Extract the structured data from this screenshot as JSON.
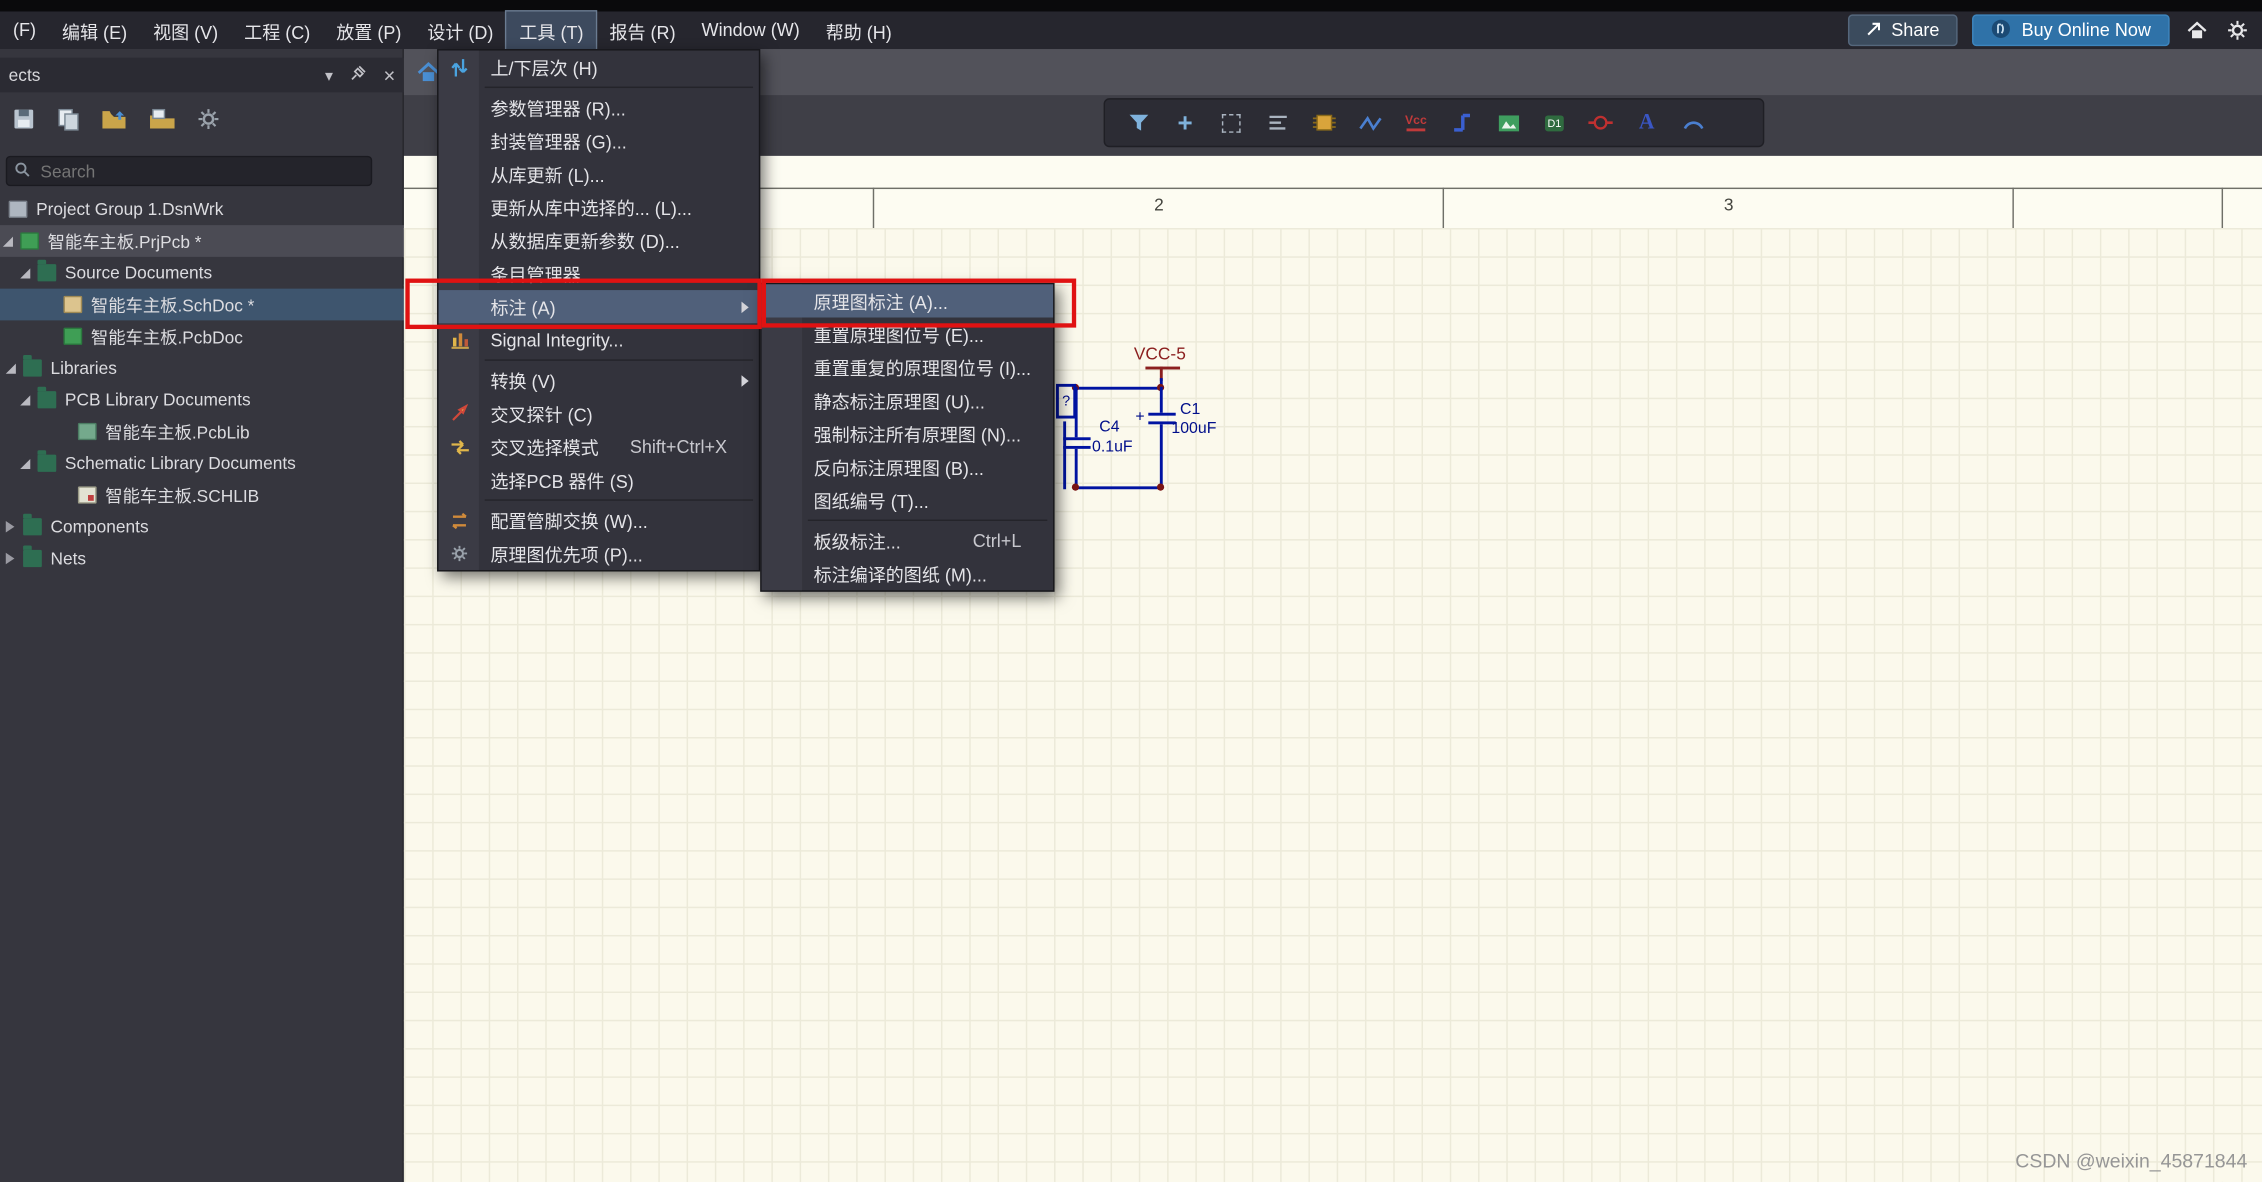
{
  "menubar": {
    "items": [
      {
        "label": "(F)"
      },
      {
        "label": "编辑 (E)"
      },
      {
        "label": "视图 (V)"
      },
      {
        "label": "工程 (C)"
      },
      {
        "label": "放置 (P)"
      },
      {
        "label": "设计 (D)"
      },
      {
        "label": "工具 (T)"
      },
      {
        "label": "报告 (R)"
      },
      {
        "label": "Window (W)"
      },
      {
        "label": "帮助 (H)"
      }
    ],
    "share_label": "Share",
    "buy_label": "Buy Online Now"
  },
  "tools_menu": {
    "items": [
      {
        "label": "上/下层次 (H)"
      },
      {
        "label": "参数管理器 (R)..."
      },
      {
        "label": "封装管理器 (G)..."
      },
      {
        "label": "从库更新 (L)..."
      },
      {
        "label": "更新从库中选择的... (L)..."
      },
      {
        "label": "从数据库更新参数 (D)..."
      },
      {
        "label": "条目管理器..."
      },
      {
        "label": "标注 (A)"
      },
      {
        "label": "Signal Integrity..."
      },
      {
        "label": "转换 (V)"
      },
      {
        "label": "交叉探针 (C)"
      },
      {
        "label": "交叉选择模式",
        "shortcut": "Shift+Ctrl+X"
      },
      {
        "label": "选择PCB 器件 (S)"
      },
      {
        "label": "配置管脚交换 (W)..."
      },
      {
        "label": "原理图优先项 (P)..."
      }
    ]
  },
  "annotate_submenu": {
    "items": [
      {
        "label": "原理图标注 (A)..."
      },
      {
        "label": "重置原理图位号 (E)..."
      },
      {
        "label": "重置重复的原理图位号 (I)..."
      },
      {
        "label": "静态标注原理图 (U)..."
      },
      {
        "label": "强制标注所有原理图 (N)..."
      },
      {
        "label": "反向标注原理图 (B)..."
      },
      {
        "label": "图纸编号 (T)..."
      },
      {
        "label": "板级标注...",
        "shortcut": "Ctrl+L"
      },
      {
        "label": "标注编译的图纸 (M)..."
      }
    ]
  },
  "projects_panel": {
    "header_title": "ects",
    "search_placeholder": "Search",
    "tree": [
      {
        "label": "Project Group 1.DsnWrk"
      },
      {
        "label": "智能车主板.PrjPcb *"
      },
      {
        "label": "Source Documents"
      },
      {
        "label": "智能车主板.SchDoc *"
      },
      {
        "label": "智能车主板.PcbDoc"
      },
      {
        "label": "Libraries"
      },
      {
        "label": "PCB Library Documents"
      },
      {
        "label": "智能车主板.PcbLib"
      },
      {
        "label": "Schematic Library Documents"
      },
      {
        "label": "智能车主板.SCHLIB"
      },
      {
        "label": "Components"
      },
      {
        "label": "Nets"
      }
    ]
  },
  "schematic": {
    "columns": [
      "2",
      "3"
    ],
    "labels": {
      "vcc_net": "VCC-5",
      "plus": "+",
      "c1_ref": "C1",
      "c1_val": "100uF",
      "c4_ref": "C4",
      "c4_val": "0.1uF",
      "unknown_ref": "?"
    }
  },
  "icons": {
    "panel_menu_glyph": "▾",
    "close_glyph": "×",
    "crosshair_glyph": "+",
    "power_port_glyph": "Vcc",
    "designator_glyph": "D1",
    "text_glyph": "A"
  },
  "watermark": "CSDN @weixin_45871844",
  "colors": {
    "accent_blue": "#2f72a8",
    "menu_highlight": "#50607a",
    "annotation_red": "#e01212",
    "wire_blue": "#0013a2",
    "net_red": "#8b1f1f",
    "sheet_bg": "#fbf9ec"
  }
}
